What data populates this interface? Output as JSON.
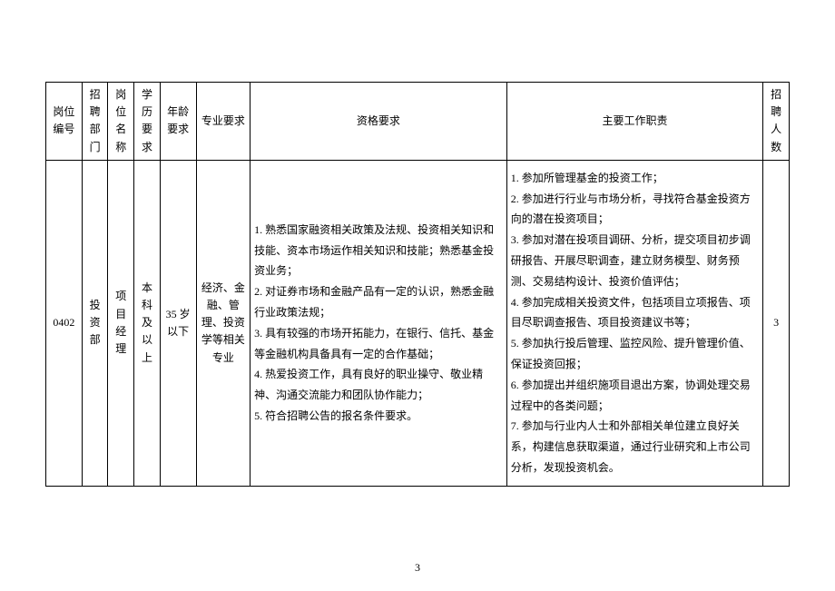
{
  "headers": {
    "code": "岗位编号",
    "dept": "招聘部门",
    "name": "岗位名称",
    "edu": "学历要求",
    "age": "年龄要求",
    "major": "专业要求",
    "qual": "资格要求",
    "resp": "主要工作职责",
    "num": "招聘人数"
  },
  "row": {
    "code": "0402",
    "dept": "投资部",
    "name": "项目经理",
    "edu": "本科及以上",
    "age": "35 岁以下",
    "major": "经济、金融、管理、投资学等相关专业",
    "qual": "1. 熟悉国家融资相关政策及法规、投资相关知识和技能、资本市场运作相关知识和技能；熟悉基金投资业务；\n2. 对证券市场和金融产品有一定的认识，熟悉金融行业政策法规；\n3. 具有较强的市场开拓能力，在银行、信托、基金等金融机构具备具有一定的合作基础；\n4. 热爱投资工作，具有良好的职业操守、敬业精神、沟通交流能力和团队协作能力；\n5. 符合招聘公告的报名条件要求。",
    "resp": "1. 参加所管理基金的投资工作；\n2. 参加进行行业与市场分析，寻找符合基金投资方向的潜在投资项目；\n3. 参加对潜在投项目调研、分析，提交项目初步调研报告、开展尽职调查，建立财务模型、财务预测、交易结构设计、投资价值评估；\n4. 参加完成相关投资文件，包括项目立项报告、项目尽职调查报告、项目投资建议书等；\n5. 参加执行投后管理、监控风险、提升管理价值、保证投资回报；\n6. 参加提出并组织施项目退出方案，协调处理交易过程中的各类问题；\n7. 参加与行业内人士和外部相关单位建立良好关系，构建信息获取渠道，通过行业研究和上市公司分析，发现投资机会。",
    "num": "3"
  },
  "page_number": "3"
}
